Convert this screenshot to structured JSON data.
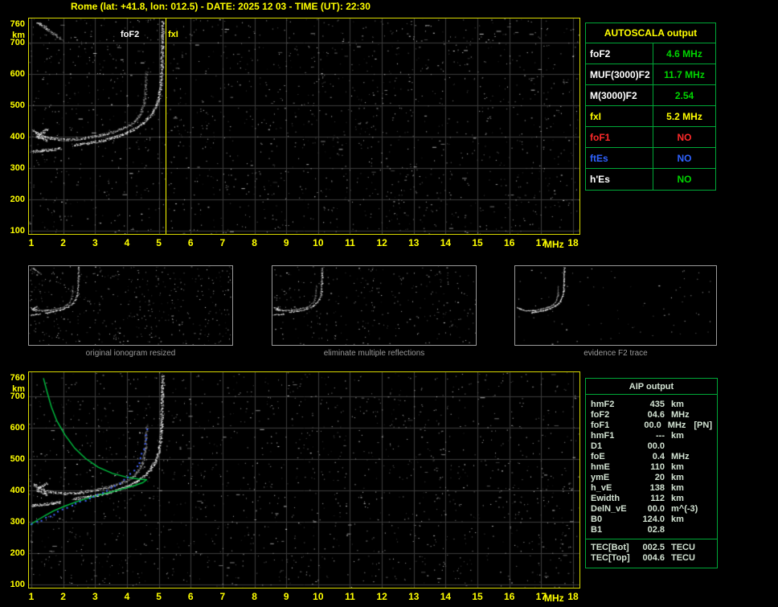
{
  "title": "Rome (lat: +41.8, lon: 012.5) - DATE: 2025 12 03 - TIME (UT): 22:30",
  "colors": {
    "yellow": "#ffff00",
    "white": "#ffffff",
    "red": "#ff2a2a",
    "blue": "#2f62ff",
    "value_green": "#00d400",
    "panel_border": "#00a838",
    "grid": "#3c3c3c",
    "caption": "#9a9a9a",
    "profile_green": "#00c040",
    "restored_blue": "#4466ff",
    "trace_white": "#ffffff"
  },
  "ionogram_labels": {
    "foF2": "foF2",
    "fxI": "fxI"
  },
  "autoscala_panel": {
    "title": "AUTOSCALA output",
    "rows": [
      {
        "label": "foF2",
        "value": "4.6 MHz",
        "label_color": "white",
        "value_color": "value_green"
      },
      {
        "label": "MUF(3000)F2",
        "value": "11.7 MHz",
        "label_color": "white",
        "value_color": "value_green"
      },
      {
        "label": "M(3000)F2",
        "value": "2.54",
        "label_color": "white",
        "value_color": "value_green"
      },
      {
        "label": "fxI",
        "value": "5.2 MHz",
        "label_color": "yellow",
        "value_color": "yellow"
      },
      {
        "label": "foF1",
        "value": "NO",
        "label_color": "red",
        "value_color": "red"
      },
      {
        "label": "ftEs",
        "value": "NO",
        "label_color": "blue",
        "value_color": "blue"
      },
      {
        "label": "h'Es",
        "value": "NO",
        "label_color": "white",
        "value_color": "value_green"
      }
    ]
  },
  "thumbnails": [
    {
      "caption": "original ionogram resized"
    },
    {
      "caption": "eliminate multiple reflections"
    },
    {
      "caption": "evidence F2 trace"
    }
  ],
  "aip_panel": {
    "title": "AIP output",
    "rows": [
      {
        "label": "hmF2",
        "value": "435",
        "unit": "km",
        "extra": ""
      },
      {
        "label": "foF2",
        "value": "04.6",
        "unit": "MHz",
        "extra": ""
      },
      {
        "label": "foF1",
        "value": "00.0",
        "unit": "MHz",
        "extra": "[PN]"
      },
      {
        "label": "hmF1",
        "value": "---",
        "unit": "km",
        "extra": ""
      },
      {
        "label": "D1",
        "value": "00.0",
        "unit": "",
        "extra": ""
      },
      {
        "label": "foE",
        "value": "0.4",
        "unit": "MHz",
        "extra": ""
      },
      {
        "label": "hmE",
        "value": "110",
        "unit": "km",
        "extra": ""
      },
      {
        "label": "ymE",
        "value": "20",
        "unit": "km",
        "extra": ""
      },
      {
        "label": "h_vE",
        "value": "138",
        "unit": "km",
        "extra": ""
      },
      {
        "label": "Ewidth",
        "value": "112",
        "unit": "km",
        "extra": ""
      },
      {
        "label": "DelN_vE",
        "value": "00.0",
        "unit": "m^(-3)",
        "extra": ""
      },
      {
        "label": "B0",
        "value": "124.0",
        "unit": "km",
        "extra": ""
      },
      {
        "label": "B1",
        "value": "02.8",
        "unit": "",
        "extra": ""
      }
    ],
    "tec_rows": [
      {
        "label": "TEC[Bot]",
        "value": "002.5",
        "unit": "TECU"
      },
      {
        "label": "TEC[Top]",
        "value": "004.6",
        "unit": "TECU"
      }
    ]
  },
  "chart_data": [
    {
      "id": "top_ionogram",
      "type": "scatter",
      "title": "recorded ionogram with AUTOSCALA critical frequency markers",
      "xlabel": "MHz",
      "ylabel": "km",
      "xlim": [
        1,
        18
      ],
      "ylim": [
        90,
        780
      ],
      "x_ticks": [
        1,
        2,
        3,
        4,
        5,
        6,
        7,
        8,
        9,
        10,
        11,
        12,
        13,
        14,
        15,
        16,
        17,
        18
      ],
      "y_ticks": [
        760,
        700,
        600,
        500,
        400,
        300,
        200,
        100
      ],
      "grid": true,
      "markers": {
        "foF2_MHz": 4.6,
        "fxI_MHz": 5.2
      },
      "background": "random white speckle noise",
      "series": [
        {
          "name": "O-mode trace",
          "style": "speckle",
          "fade": true,
          "points": [
            [
              1.05,
              421
            ],
            [
              1.2,
              410
            ],
            [
              1.4,
              401
            ],
            [
              1.7,
              394
            ],
            [
              2.0,
              391
            ],
            [
              2.4,
              392
            ],
            [
              2.8,
              398
            ],
            [
              3.2,
              406
            ],
            [
              3.6,
              417
            ],
            [
              4.0,
              432
            ],
            [
              4.25,
              450
            ],
            [
              4.4,
              470
            ],
            [
              4.5,
              497
            ],
            [
              4.56,
              532
            ],
            [
              4.59,
              572
            ],
            [
              4.61,
              612
            ]
          ]
        },
        {
          "name": "X-mode trace",
          "style": "speckle",
          "points": [
            [
              2.3,
              374
            ],
            [
              2.7,
              379
            ],
            [
              3.1,
              386
            ],
            [
              3.5,
              396
            ],
            [
              3.9,
              409
            ],
            [
              4.25,
              426
            ],
            [
              4.55,
              448
            ],
            [
              4.75,
              470
            ],
            [
              4.9,
              497
            ],
            [
              5.0,
              530
            ],
            [
              5.05,
              568
            ],
            [
              5.08,
              614
            ],
            [
              5.09,
              664
            ],
            [
              5.1,
              716
            ],
            [
              5.11,
              770
            ]
          ]
        },
        {
          "name": "low-range echo",
          "style": "speckle",
          "points": [
            [
              1.0,
              352
            ],
            [
              1.3,
              356
            ],
            [
              1.6,
              359
            ],
            [
              1.9,
              363
            ]
          ]
        },
        {
          "name": "cusp arrow",
          "style": "speckle",
          "points": [
            [
              1.5,
              425
            ],
            [
              1.16,
              402
            ],
            [
              1.5,
              386
            ]
          ]
        },
        {
          "name": "oblique streak",
          "style": "speckle",
          "fade": true,
          "points": [
            [
              1.18,
              765
            ],
            [
              1.55,
              740
            ],
            [
              1.95,
              708
            ]
          ]
        }
      ]
    },
    {
      "id": "bottom_ionogram",
      "type": "scatter",
      "title": "ionogram with restored trace and electron density profile",
      "xlabel": "MHz",
      "ylabel": "km",
      "xlim": [
        1,
        18
      ],
      "ylim": [
        90,
        780
      ],
      "x_ticks": [
        1,
        2,
        3,
        4,
        5,
        6,
        7,
        8,
        9,
        10,
        11,
        12,
        13,
        14,
        15,
        16,
        17,
        18
      ],
      "y_ticks": [
        760,
        700,
        600,
        500,
        400,
        300,
        200,
        100
      ],
      "grid": true,
      "background": "random white speckle noise",
      "series": [
        {
          "name": "O-mode trace",
          "style": "speckle",
          "fade": true,
          "points": [
            [
              1.05,
              421
            ],
            [
              1.2,
              410
            ],
            [
              1.4,
              401
            ],
            [
              1.7,
              394
            ],
            [
              2.0,
              391
            ],
            [
              2.4,
              392
            ],
            [
              2.8,
              398
            ],
            [
              3.2,
              406
            ],
            [
              3.6,
              417
            ],
            [
              4.0,
              432
            ],
            [
              4.25,
              450
            ],
            [
              4.4,
              470
            ],
            [
              4.5,
              497
            ],
            [
              4.56,
              532
            ],
            [
              4.59,
              572
            ],
            [
              4.61,
              612
            ]
          ]
        },
        {
          "name": "X-mode trace",
          "style": "speckle",
          "points": [
            [
              2.3,
              374
            ],
            [
              2.7,
              379
            ],
            [
              3.1,
              386
            ],
            [
              3.5,
              396
            ],
            [
              3.9,
              409
            ],
            [
              4.25,
              426
            ],
            [
              4.55,
              448
            ],
            [
              4.75,
              470
            ],
            [
              4.9,
              497
            ],
            [
              5.0,
              530
            ],
            [
              5.05,
              568
            ],
            [
              5.08,
              614
            ],
            [
              5.09,
              664
            ],
            [
              5.1,
              716
            ],
            [
              5.11,
              770
            ]
          ]
        },
        {
          "name": "low-range echo",
          "style": "speckle",
          "points": [
            [
              1.0,
              352
            ],
            [
              1.3,
              356
            ],
            [
              1.6,
              359
            ],
            [
              1.9,
              363
            ]
          ]
        },
        {
          "name": "cusp arrow",
          "style": "speckle",
          "points": [
            [
              1.5,
              425
            ],
            [
              1.16,
              402
            ],
            [
              1.5,
              386
            ]
          ]
        },
        {
          "name": "N(h) profile",
          "style": "line",
          "color": "#00c040",
          "points": [
            [
              1.38,
              758
            ],
            [
              1.5,
              712
            ],
            [
              1.63,
              666
            ],
            [
              1.8,
              622
            ],
            [
              2.05,
              578
            ],
            [
              2.35,
              536
            ],
            [
              2.7,
              502
            ],
            [
              3.1,
              474
            ],
            [
              3.55,
              454
            ],
            [
              4.0,
              442
            ],
            [
              4.4,
              436
            ],
            [
              4.62,
              434
            ],
            [
              4.5,
              425
            ],
            [
              4.2,
              414
            ],
            [
              3.8,
              403
            ],
            [
              3.35,
              391
            ],
            [
              2.9,
              379
            ],
            [
              2.45,
              365
            ],
            [
              2.05,
              350
            ],
            [
              1.7,
              335
            ],
            [
              1.45,
              321
            ],
            [
              1.22,
              307
            ],
            [
              1.04,
              296
            ],
            [
              0.97,
              290
            ]
          ]
        },
        {
          "name": "restored true-height trace",
          "style": "dots",
          "color": "#4466ff",
          "points": [
            [
              1.0,
              295
            ],
            [
              1.3,
              309
            ],
            [
              1.6,
              323
            ],
            [
              1.9,
              337
            ],
            [
              2.2,
              351
            ],
            [
              2.5,
              364
            ],
            [
              2.8,
              377
            ],
            [
              3.1,
              391
            ],
            [
              3.4,
              406
            ],
            [
              3.7,
              422
            ],
            [
              3.95,
              440
            ],
            [
              4.15,
              459
            ],
            [
              4.3,
              480
            ],
            [
              4.42,
              505
            ],
            [
              4.5,
              535
            ],
            [
              4.56,
              570
            ],
            [
              4.6,
              605
            ]
          ]
        }
      ]
    }
  ]
}
